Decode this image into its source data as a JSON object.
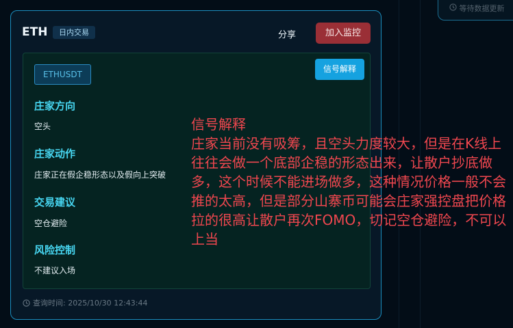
{
  "right_card": {
    "status": "等待数据更新"
  },
  "header": {
    "symbol": "ETH",
    "type_badge": "日内交易",
    "share_label": "分享",
    "monitor_label": "加入监控"
  },
  "panel": {
    "ticker": "ETHUSDT",
    "explain_label": "信号解释",
    "sections": [
      {
        "title": "庄家方向",
        "value": "空头"
      },
      {
        "title": "庄家动作",
        "value": "庄家正在假企稳形态以及假向上突破"
      },
      {
        "title": "交易建议",
        "value": "空仓避险"
      },
      {
        "title": "风险控制",
        "value": "不建议入场"
      }
    ]
  },
  "footer": {
    "query_time": "查询时间: 2025/10/30 12:43:44"
  },
  "tooltip": {
    "title": "信号解释",
    "body": "庄家当前没有吸筹，且空头力度较大，但是在K线上往往会做一个底部企稳的形态出来，让散户抄底做多，这个时候不能进场做多，这种情况价格一般不会推的太高，但是部分山寨币可能会庄家强控盘把价格拉的很高让散户再次FOMO，切记空仓避险，不可以上当"
  },
  "colors": {
    "accent_border": "#1b8fc0",
    "monitor_button": "#9a2f36",
    "explain_button": "#15a2e0",
    "section_title": "#47d6f1",
    "tooltip_text": "#f0474f"
  }
}
